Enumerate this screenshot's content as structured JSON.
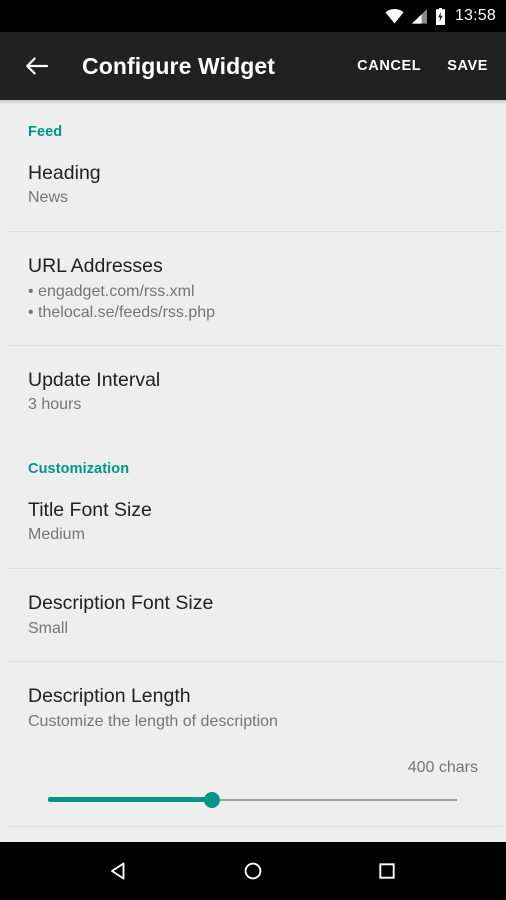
{
  "status_bar": {
    "time": "13:58",
    "icons": [
      "wifi-icon",
      "cellular-signal-icon",
      "battery-charging-icon"
    ]
  },
  "toolbar": {
    "back_icon": "arrow-left-icon",
    "title": "Configure Widget",
    "cancel_label": "CANCEL",
    "save_label": "SAVE"
  },
  "theme": {
    "accent": "#009688",
    "toolbar_bg": "#212121",
    "content_bg": "#eeeeee",
    "primary_text": "#212121",
    "secondary_text": "#757575",
    "divider": "#dcdcdc"
  },
  "sections": [
    {
      "header": "Feed",
      "items": [
        {
          "title": "Heading",
          "summary": "News"
        },
        {
          "title": "URL Addresses",
          "urls": [
            "• engadget.com/rss.xml",
            "• thelocal.se/feeds/rss.php"
          ]
        },
        {
          "title": "Update Interval",
          "summary": "3 hours"
        }
      ]
    },
    {
      "header": "Customization",
      "items": [
        {
          "title": "Title Font Size",
          "summary": "Medium"
        },
        {
          "title": "Description Font Size",
          "summary": "Small"
        },
        {
          "title": "Description Length",
          "summary": "Customize the length of description",
          "slider": {
            "value_label": "400 chars",
            "percent": 40
          }
        }
      ]
    }
  ],
  "nav_bar": {
    "back_label": "back-triangle-icon",
    "home_label": "home-circle-icon",
    "recents_label": "recents-square-icon"
  }
}
